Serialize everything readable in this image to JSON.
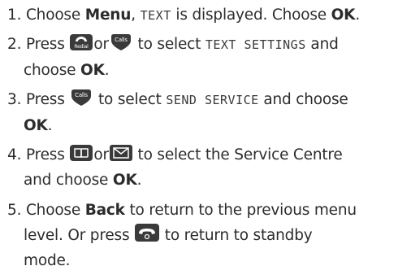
{
  "steps": [
    {
      "number": "1.",
      "prefix": "Choose ",
      "menu": "Menu",
      "comma": ", ",
      "display": "TEXT",
      "mid": " is displayed. Choose ",
      "ok": "OK",
      "end": "."
    },
    {
      "number": "2.",
      "press": "Press ",
      "icon1": "redial-key-icon",
      "or": "or",
      "icon2": "calls-key-icon",
      "to_select": " to select ",
      "display": "TEXT SETTINGS",
      "and": " and",
      "choose": "choose ",
      "ok": "OK",
      "end": "."
    },
    {
      "number": "3.",
      "press": "Press ",
      "icon1": "calls-key-icon",
      "to_select": " to select ",
      "display": "SEND SERVICE",
      "and_choose": " and choose",
      "ok": "OK",
      "end": "."
    },
    {
      "number": "4.",
      "press": "Press ",
      "icon1": "phonebook-key-icon",
      "or": "or",
      "icon2": "envelope-key-icon",
      "rest": " to select the Service Centre",
      "and_choose": "and choose ",
      "ok": "OK",
      "end": "."
    },
    {
      "number": "5.",
      "prefix": "Choose ",
      "back": "Back",
      "rest1": " to return to the previous menu",
      "line2a": "level. Or press ",
      "icon1": "end-call-key-icon",
      "line2b": " to return to standby",
      "line3": "mode."
    }
  ],
  "colors": {
    "text": "#2c2c2c",
    "key_fill": "#3a3a3a",
    "key_text": "#ffffff"
  }
}
